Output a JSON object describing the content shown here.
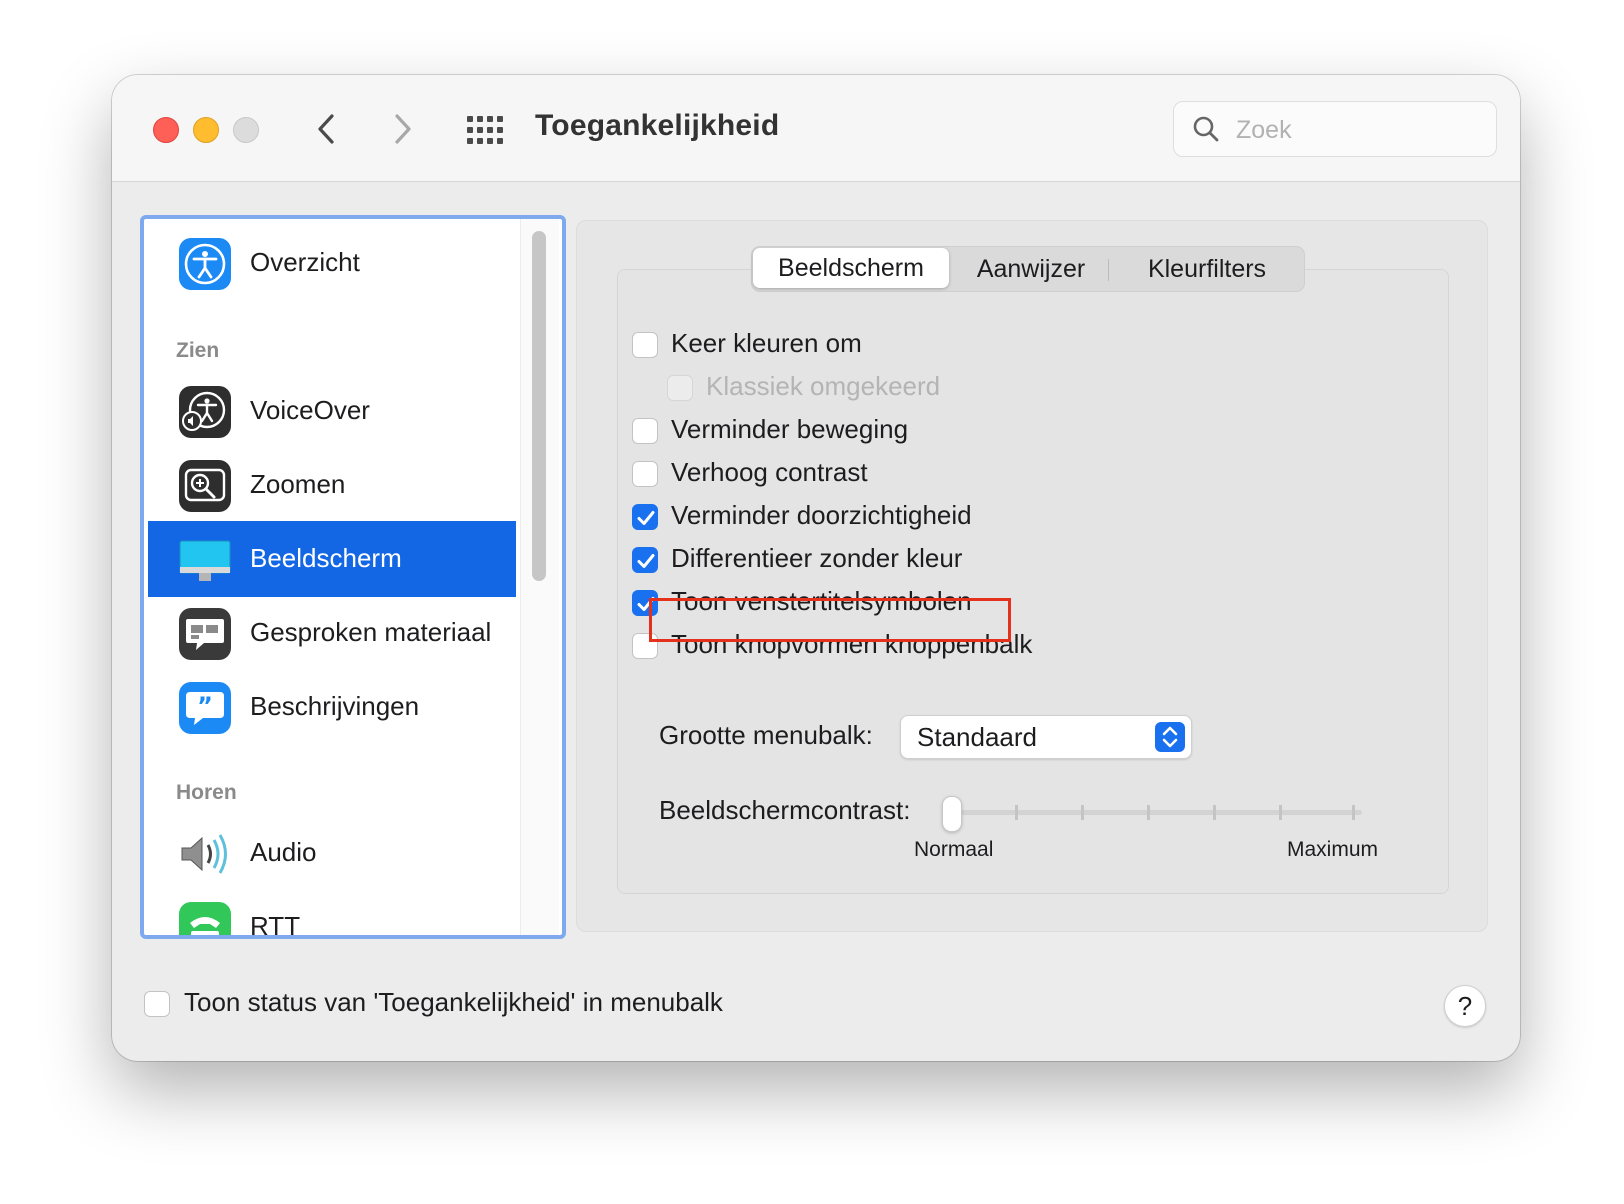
{
  "window": {
    "title": "Toegankelijkheid",
    "search_placeholder": "Zoek"
  },
  "sidebar": {
    "items": [
      {
        "label": "Overzicht",
        "icon": "accessibility-icon"
      },
      {
        "label": "VoiceOver",
        "icon": "voiceover-icon"
      },
      {
        "label": "Zoomen",
        "icon": "zoom-icon"
      },
      {
        "label": "Beeldscherm",
        "icon": "display-icon",
        "selected": true
      },
      {
        "label": "Gesproken materiaal",
        "icon": "spoken-content-icon"
      },
      {
        "label": "Beschrijvingen",
        "icon": "descriptions-icon"
      },
      {
        "label": "Audio",
        "icon": "speaker-icon"
      },
      {
        "label": "RTT",
        "icon": "rtt-phone-icon"
      }
    ],
    "sections": {
      "see": "Zien",
      "hear": "Horen"
    }
  },
  "tabs": [
    {
      "label": "Beeldscherm",
      "active": true
    },
    {
      "label": "Aanwijzer",
      "active": false
    },
    {
      "label": "Kleurfilters",
      "active": false
    }
  ],
  "options": [
    {
      "label": "Keer kleuren om",
      "checked": false
    },
    {
      "label": "Klassiek omgekeerd",
      "checked": false,
      "disabled": true
    },
    {
      "label": "Verminder beweging",
      "checked": false
    },
    {
      "label": "Verhoog contrast",
      "checked": false
    },
    {
      "label": "Verminder doorzichtigheid",
      "checked": true
    },
    {
      "label": "Differentieer zonder kleur",
      "checked": true
    },
    {
      "label": "Toon venstertitelsymbolen",
      "checked": true,
      "highlighted": true
    },
    {
      "label": "Toon knopvormen knoppenbalk",
      "checked": false
    }
  ],
  "menubar_size": {
    "label": "Grootte menubalk:",
    "value": "Standaard"
  },
  "contrast": {
    "label": "Beeldschermcontrast:",
    "min_label": "Normaal",
    "max_label": "Maximum",
    "value_fraction": 0
  },
  "footer": {
    "status_label": "Toon status van 'Toegankelijkheid' in menubalk",
    "status_checked": false,
    "help_label": "?"
  },
  "colors": {
    "accent": "#1a71f0",
    "highlight_border": "#e5301b",
    "selection": "#1467e4"
  }
}
